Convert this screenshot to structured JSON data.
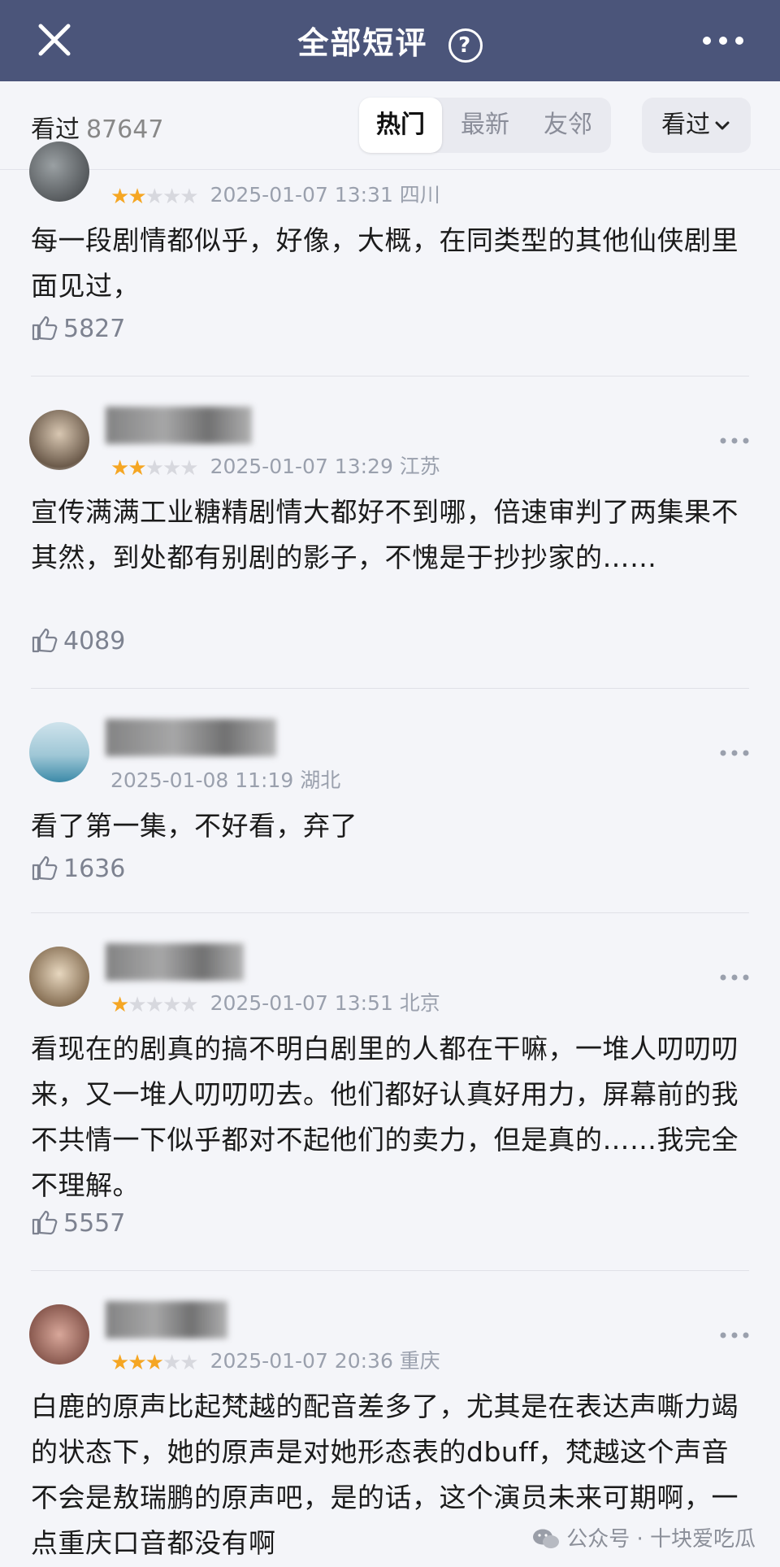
{
  "header": {
    "title": "全部短评",
    "help_symbol": "?"
  },
  "filter": {
    "watched_label": "看过",
    "watched_count": "87647",
    "tabs": [
      {
        "label": "热门",
        "active": true
      },
      {
        "label": "最新",
        "active": false
      },
      {
        "label": "友邻",
        "active": false
      }
    ],
    "sort_label": "看过"
  },
  "comments": [
    {
      "stars": 2,
      "date": "2025-01-07 13:31",
      "location": "四川",
      "text": "每一段剧情都似乎，好像，大概，在同类型的其他仙侠剧里面见过，",
      "likes": "5827"
    },
    {
      "stars": 2,
      "date": "2025-01-07 13:29",
      "location": "江苏",
      "text": "宣传满满工业糖精剧情大都好不到哪，倍速审判了两集果不其然，到处都有别剧的影子，不愧是于抄抄家的……",
      "likes": "4089"
    },
    {
      "stars": 0,
      "date": "2025-01-08 11:19",
      "location": "湖北",
      "text": "看了第一集，不好看，弃了",
      "likes": "1636"
    },
    {
      "stars": 1,
      "date": "2025-01-07 13:51",
      "location": "北京",
      "text": "看现在的剧真的搞不明白剧里的人都在干嘛，一堆人叨叨叨来，又一堆人叨叨叨去。他们都好认真好用力，屏幕前的我不共情一下似乎都对不起他们的卖力，但是真的……我完全不理解。",
      "likes": "5557"
    },
    {
      "stars": 3,
      "date": "2025-01-07 20:36",
      "location": "重庆",
      "text": "白鹿的原声比起梵越的配音差多了，尤其是在表达声嘶力竭的状态下，她的原声是对她形态表的dbuff，梵越这个声音不会是敖瑞鹏的原声吧，是的话，这个演员未来可期啊，一点重庆口音都没有啊",
      "likes": ""
    }
  ],
  "watermark": "公众号 · 十块爱吃瓜",
  "colors": {
    "header_bg": "#4b557a",
    "star_on": "#f5a623",
    "star_off": "#d7d8de"
  }
}
